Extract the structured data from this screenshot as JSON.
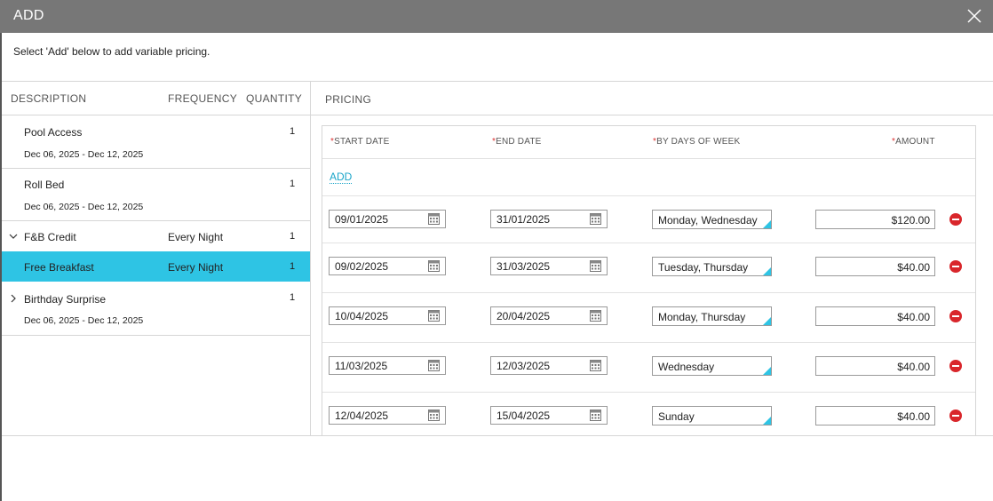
{
  "dialog": {
    "title": "ADD",
    "instruction": "Select 'Add' below to add variable pricing.",
    "close_icon": "close-icon"
  },
  "left": {
    "headers": {
      "description": "DESCRIPTION",
      "frequency": "FREQUENCY",
      "quantity": "QUANTITY"
    },
    "items": [
      {
        "name": "Pool Access",
        "frequency": "",
        "quantity": "1",
        "dates": "Dec 06, 2025 - Dec 12, 2025",
        "expander": ""
      },
      {
        "name": "Roll Bed",
        "frequency": "",
        "quantity": "1",
        "dates": "Dec 06, 2025 - Dec 12, 2025",
        "expander": ""
      },
      {
        "name": "F&B Credit",
        "frequency": "Every Night",
        "quantity": "1",
        "dates": "",
        "expander": "chevron-down-icon"
      },
      {
        "name": "Free Breakfast",
        "frequency": "Every Night",
        "quantity": "1",
        "dates": "",
        "expander": "",
        "selected": true
      },
      {
        "name": "Birthday Surprise",
        "frequency": "",
        "quantity": "1",
        "dates": "Dec 06, 2025 - Dec 12, 2025",
        "expander": "chevron-right-icon"
      }
    ]
  },
  "pricing": {
    "title": "PRICING",
    "headers": {
      "required_mark": "*",
      "start": "START DATE",
      "end": "END DATE",
      "days": "BY DAYS OF WEEK",
      "amount": "AMOUNT"
    },
    "add_label": "ADD",
    "rows": [
      {
        "start": "09/01/2025",
        "end": "31/01/2025",
        "days": "Monday, Wednesday",
        "amount": "$120.00"
      },
      {
        "start": "09/02/2025",
        "end": "31/03/2025",
        "days": "Tuesday, Thursday",
        "amount": "$40.00"
      },
      {
        "start": "10/04/2025",
        "end": "20/04/2025",
        "days": "Monday, Thursday",
        "amount": "$40.00"
      },
      {
        "start": "11/03/2025",
        "end": "12/03/2025",
        "days": "Wednesday",
        "amount": "$40.00"
      },
      {
        "start": "12/04/2025",
        "end": "15/04/2025",
        "days": "Sunday",
        "amount": "$40.00"
      }
    ]
  },
  "colors": {
    "titlebar": "#777777",
    "selected_row": "#2ec4e4",
    "link": "#1ba5c9",
    "delete": "#d9262b",
    "required": "#dd3333"
  }
}
